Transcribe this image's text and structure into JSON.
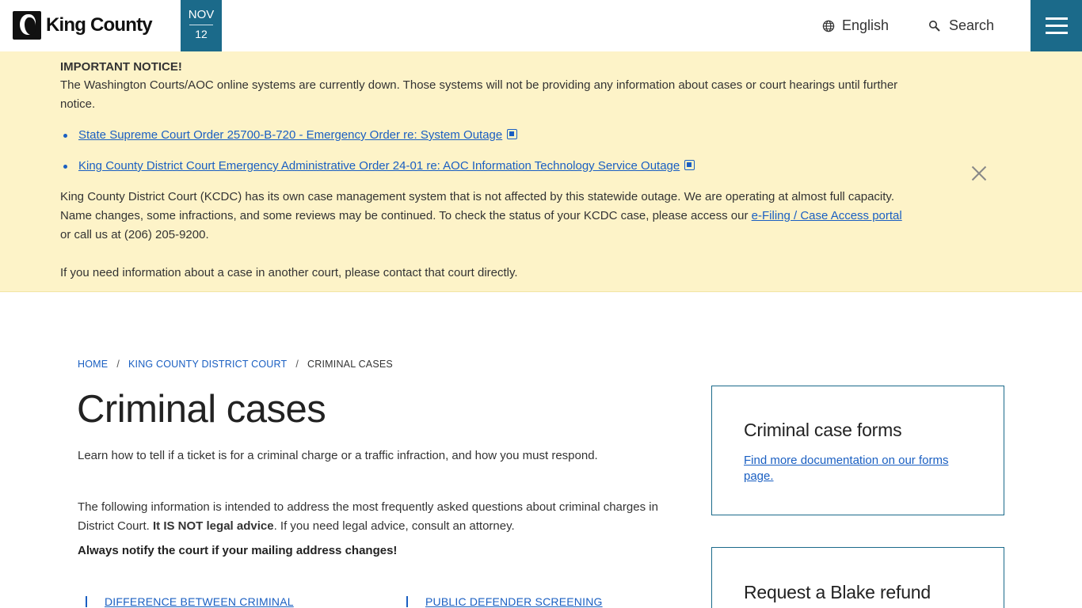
{
  "header": {
    "logo_text": "King County",
    "date_month": "NOV",
    "date_day": "12",
    "language_label": "English",
    "search_label": "Search"
  },
  "notice": {
    "title": "IMPORTANT NOTICE!",
    "body": "The Washington Courts/AOC online systems are currently down. Those systems will not be providing any information about cases or court hearings until further notice.",
    "links": [
      "State Supreme Court Order 25700-B-720 - Emergency Order re: System Outage",
      "King County District Court Emergency Administrative Order 24-01 re: AOC Information Technology Service Outage"
    ],
    "para1_before": "King County District Court (KCDC) has its own case management system that is not affected by this statewide outage. We are operating at almost full capacity. Name changes, some infractions, and some reviews may be continued. To check the status of your KCDC case, please access our ",
    "para1_link": "e-Filing / Case Access portal",
    "para1_after": " or call us at (206) 205-9200.",
    "para2": "If you need information about a case in another court, please contact that court directly."
  },
  "breadcrumb": {
    "home": "HOME",
    "parent": "KING COUNTY DISTRICT COURT",
    "current": "CRIMINAL CASES",
    "separator": "/"
  },
  "main": {
    "title": "Criminal cases",
    "lead": "Learn how to tell if a ticket is for a criminal charge or a traffic infraction, and how you must respond.",
    "info_before": "The following information is intended to address the most frequently asked questions about criminal charges in District Court. ",
    "info_bold": "It IS NOT legal advice",
    "info_after": ". If you need legal advice, consult an attorney.",
    "notify": "Always notify the court if your mailing address changes!",
    "jump_links": [
      "DIFFERENCE BETWEEN CRIMINAL",
      "PUBLIC DEFENDER SCREENING"
    ]
  },
  "sidebar": {
    "card1_title": "Criminal case forms",
    "card1_link": "Find more documentation on our forms page.",
    "card2_title": "Request a Blake refund"
  },
  "colors": {
    "brand_teal": "#1b6a8a",
    "notice_bg": "#fdf3c8",
    "link": "#1a5fc2"
  },
  "icons": {
    "language": "globe-icon",
    "search": "search-icon",
    "menu": "hamburger-menu-icon",
    "close": "close-icon",
    "pdf": "pdf-file-icon"
  }
}
